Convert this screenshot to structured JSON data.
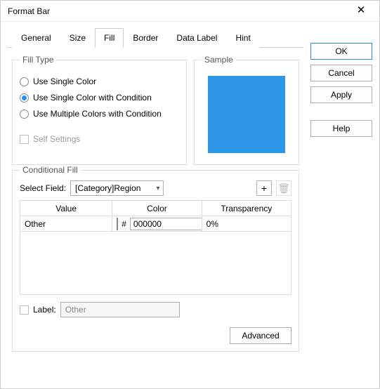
{
  "dialog": {
    "title": "Format Bar"
  },
  "tabs": {
    "items": [
      "General",
      "Size",
      "Fill",
      "Border",
      "Data Label",
      "Hint"
    ],
    "active": 2
  },
  "buttons": {
    "ok": "OK",
    "cancel": "Cancel",
    "apply": "Apply",
    "help": "Help"
  },
  "fill": {
    "group_label": "Fill Type",
    "opt_single": "Use Single Color",
    "opt_single_cond": "Use Single Color with Condition",
    "opt_multi_cond": "Use Multiple Colors with Condition",
    "selected": 1,
    "self_settings": "Self Settings"
  },
  "sample": {
    "group_label": "Sample",
    "color": "#2e96e6"
  },
  "cond": {
    "group_label": "Conditional Fill",
    "select_field_label": "Select Field:",
    "select_field_value": "[Category]Region",
    "col_value": "Value",
    "col_color": "Color",
    "col_transparency": "Transparency",
    "rows": [
      {
        "value": "Other",
        "hex": "000000",
        "transparency": "0%"
      }
    ],
    "label_label": "Label:",
    "label_value": "Other",
    "advanced": "Advanced"
  }
}
